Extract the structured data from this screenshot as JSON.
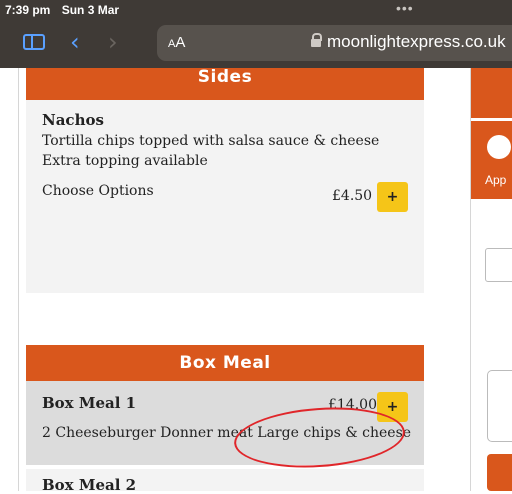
{
  "status_bar": {
    "time": "7:39 pm",
    "date": "Sun 3 Mar"
  },
  "browser": {
    "text_size_label_small": "A",
    "text_size_label_large": "A",
    "url": "moonlightexpress.co.uk"
  },
  "menu": {
    "sides_heading": "Sides",
    "nachos": {
      "name": "Nachos",
      "description": "Tortilla chips topped with salsa sauce & cheese Extra topping available",
      "options_label": "Choose Options",
      "price": "£4.50",
      "add_label": "+"
    },
    "box_heading": "Box Meal",
    "box_meal_1": {
      "name": "Box Meal 1",
      "price": "£14.00",
      "add_label": "+",
      "description": "2 Cheeseburger Donner meat Large chips & cheese"
    },
    "box_meal_2": {
      "name": "Box Meal 2"
    }
  },
  "right_panel": {
    "label": "App"
  },
  "colors": {
    "brand_orange": "#d9571c",
    "add_button": "#f5c518",
    "annotation": "#e0262a"
  }
}
